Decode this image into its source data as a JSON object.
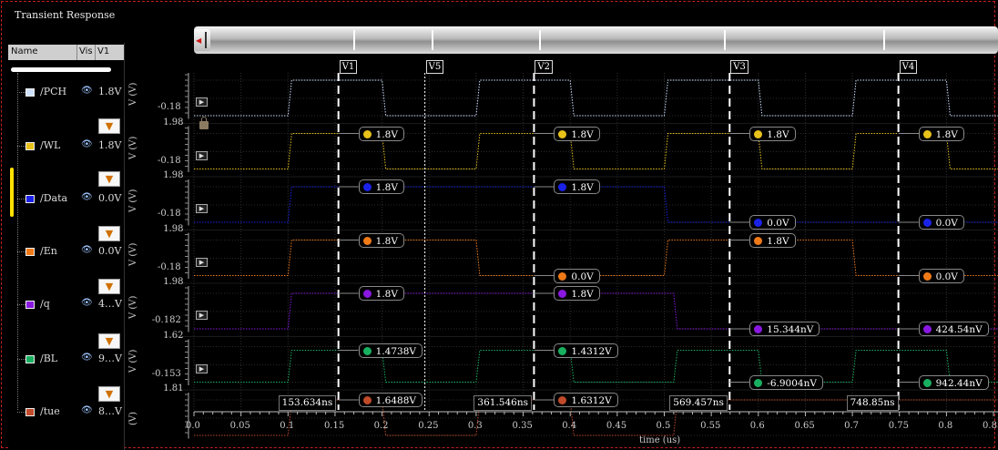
{
  "window": {
    "title": "Transient Response"
  },
  "sidebar": {
    "headers": {
      "name": "Name",
      "vis": "Vis",
      "value": "V1"
    },
    "signals": [
      {
        "name": "/PCH",
        "value": "1.8V",
        "color": "#cfe2ff",
        "filter": false
      },
      {
        "name": "/WL",
        "value": "1.8V",
        "color": "#e8c21a",
        "filter": true
      },
      {
        "name": "/Data",
        "value": "0.0V",
        "color": "#1a22e8",
        "filter": true
      },
      {
        "name": "/En",
        "value": "0.0V",
        "color": "#f07a18",
        "filter": true
      },
      {
        "name": "/q",
        "value": "4…V",
        "color": "#8a18e0",
        "filter": true
      },
      {
        "name": "/BL",
        "value": "9…V",
        "color": "#18b060",
        "filter": true
      },
      {
        "name": "/tue",
        "value": "8…V",
        "color": "#c04a2a",
        "filter": true
      }
    ]
  },
  "strips": [
    {
      "signal": "/PCH",
      "ylabel": "V (V)",
      "ytop": "",
      "ybot": "-0.18"
    },
    {
      "signal": "/WL",
      "ylabel": "V (V)",
      "ytop": "1.98",
      "ybot": "-0.18"
    },
    {
      "signal": "/Data",
      "ylabel": "V (V)",
      "ytop": "1.98",
      "ybot": "-0.18"
    },
    {
      "signal": "/En",
      "ylabel": "V (V)",
      "ytop": "1.98",
      "ybot": "-0.18"
    },
    {
      "signal": "/q",
      "ylabel": "V (V)",
      "ytop": "1.98",
      "ybot": "-0.182"
    },
    {
      "signal": "/BL",
      "ylabel": "V (V)",
      "ytop": "1.62",
      "ybot": "-0.153"
    },
    {
      "signal": "/tue",
      "ylabel": "(V)",
      "ytop": "1.81",
      "ybot": ""
    }
  ],
  "xaxis": {
    "label": "time (us)",
    "ticks": [
      "0.0",
      "0.05",
      "0.1",
      "0.15",
      "0.2",
      "0.25",
      "0.3",
      "0.35",
      "0.4",
      "0.45",
      "0.5",
      "0.55",
      "0.6",
      "0.65",
      "0.7",
      "0.75",
      "0.8",
      "0.85"
    ]
  },
  "cursors": [
    {
      "name": "V1",
      "t": 0.1536,
      "style": "dashed"
    },
    {
      "name": "V5",
      "t": 0.2455,
      "style": "dotted"
    },
    {
      "name": "V2",
      "t": 0.3615,
      "style": "dashed"
    },
    {
      "name": "V3",
      "t": 0.5695,
      "style": "dashed"
    },
    {
      "name": "V4",
      "t": 0.7489,
      "style": "dashed"
    }
  ],
  "time_labels": [
    "153.634ns",
    "361.546ns",
    "569.457ns",
    "748.85ns"
  ],
  "markers": [
    {
      "strip": 1,
      "cursor": "V1",
      "value": "1.8V",
      "level": "high"
    },
    {
      "strip": 1,
      "cursor": "V2",
      "value": "1.8V",
      "level": "high"
    },
    {
      "strip": 1,
      "cursor": "V3",
      "value": "1.8V",
      "level": "high"
    },
    {
      "strip": 1,
      "cursor": "V4",
      "value": "1.8V",
      "level": "high"
    },
    {
      "strip": 2,
      "cursor": "V1",
      "value": "1.8V",
      "level": "high"
    },
    {
      "strip": 2,
      "cursor": "V2",
      "value": "1.8V",
      "level": "high"
    },
    {
      "strip": 2,
      "cursor": "V3",
      "value": "0.0V",
      "level": "low"
    },
    {
      "strip": 2,
      "cursor": "V4",
      "value": "0.0V",
      "level": "low"
    },
    {
      "strip": 3,
      "cursor": "V1",
      "value": "1.8V",
      "level": "high"
    },
    {
      "strip": 3,
      "cursor": "V2",
      "value": "0.0V",
      "level": "low"
    },
    {
      "strip": 3,
      "cursor": "V3",
      "value": "1.8V",
      "level": "high"
    },
    {
      "strip": 3,
      "cursor": "V4",
      "value": "0.0V",
      "level": "low"
    },
    {
      "strip": 4,
      "cursor": "V1",
      "value": "1.8V",
      "level": "high"
    },
    {
      "strip": 4,
      "cursor": "V2",
      "value": "1.8V",
      "level": "high"
    },
    {
      "strip": 4,
      "cursor": "V3",
      "value": "15.344nV",
      "level": "low"
    },
    {
      "strip": 4,
      "cursor": "V4",
      "value": "424.54nV",
      "level": "low"
    },
    {
      "strip": 5,
      "cursor": "V1",
      "value": "1.4738V",
      "level": "high"
    },
    {
      "strip": 5,
      "cursor": "V2",
      "value": "1.4312V",
      "level": "high"
    },
    {
      "strip": 5,
      "cursor": "V3",
      "value": "-6.9004nV",
      "level": "low"
    },
    {
      "strip": 5,
      "cursor": "V4",
      "value": "942.44nV",
      "level": "low"
    },
    {
      "strip": 6,
      "cursor": "V1",
      "value": "1.6488V",
      "level": "high"
    },
    {
      "strip": 6,
      "cursor": "V2",
      "value": "1.6312V",
      "level": "high"
    }
  ],
  "waveforms": [
    {
      "strip": 0,
      "color": "#cfe2ff",
      "start": "low",
      "toggles": [
        0.1,
        0.2,
        0.3,
        0.4,
        0.5,
        0.6,
        0.7,
        0.8
      ]
    },
    {
      "strip": 1,
      "color": "#e8c21a",
      "start": "low",
      "toggles": [
        0.1,
        0.2,
        0.3,
        0.4,
        0.5,
        0.6,
        0.7,
        0.8
      ]
    },
    {
      "strip": 2,
      "color": "#1a22e8",
      "start": "low",
      "toggles": [
        0.1,
        0.5
      ]
    },
    {
      "strip": 3,
      "color": "#f07a18",
      "start": "low",
      "toggles": [
        0.1,
        0.3,
        0.5,
        0.7
      ]
    },
    {
      "strip": 4,
      "color": "#8a18e0",
      "start": "low",
      "toggles": [
        0.1,
        0.51
      ]
    },
    {
      "strip": 5,
      "color": "#18b060",
      "start": "low",
      "toggles": [
        0.1,
        0.2,
        0.3,
        0.4,
        0.51,
        0.6,
        0.7,
        0.8
      ]
    },
    {
      "strip": 6,
      "color": "#c04a2a",
      "start": "low",
      "toggles": [
        0.1,
        0.2,
        0.3,
        0.4,
        0.51
      ]
    }
  ]
}
